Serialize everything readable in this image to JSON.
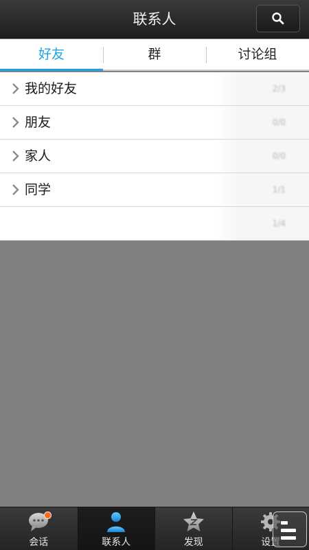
{
  "header": {
    "title": "联系人",
    "search_icon": "search-icon"
  },
  "tabs": [
    {
      "label": "好友",
      "active": true
    },
    {
      "label": "群",
      "active": false
    },
    {
      "label": "讨论组",
      "active": false
    }
  ],
  "groups": [
    {
      "name": "我的好友",
      "count": "2/3"
    },
    {
      "name": "朋友",
      "count": "0/0"
    },
    {
      "name": "家人",
      "count": "0/0"
    },
    {
      "name": "同学",
      "count": "1/1"
    },
    {
      "name": "",
      "count": "1/4"
    }
  ],
  "bottom_nav": [
    {
      "label": "会话",
      "icon": "chat-bubble-icon",
      "badge": true
    },
    {
      "label": "联系人",
      "icon": "person-icon",
      "active": true
    },
    {
      "label": "发现",
      "icon": "star-icon"
    },
    {
      "label": "设置",
      "icon": "gear-icon"
    }
  ],
  "colors": {
    "accent": "#1fa3e0",
    "badge": "#ff6a1a",
    "background": "#808080"
  }
}
